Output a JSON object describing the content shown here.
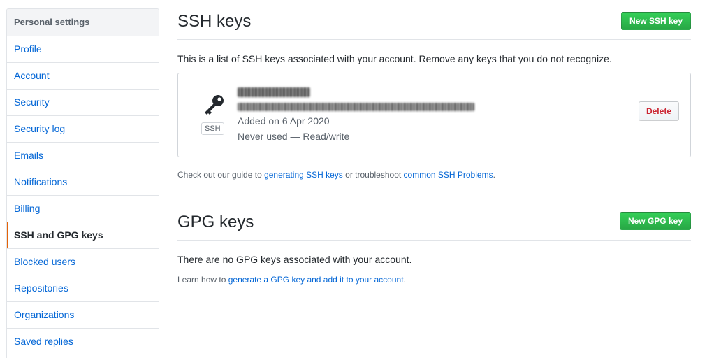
{
  "sidebar": {
    "header": "Personal settings",
    "items": [
      {
        "label": "Profile"
      },
      {
        "label": "Account"
      },
      {
        "label": "Security"
      },
      {
        "label": "Security log"
      },
      {
        "label": "Emails"
      },
      {
        "label": "Notifications"
      },
      {
        "label": "Billing"
      },
      {
        "label": "SSH and GPG keys",
        "selected": true
      },
      {
        "label": "Blocked users"
      },
      {
        "label": "Repositories"
      },
      {
        "label": "Organizations"
      },
      {
        "label": "Saved replies"
      }
    ]
  },
  "ssh": {
    "title": "SSH keys",
    "new_button": "New SSH key",
    "description": "This is a list of SSH keys associated with your account. Remove any keys that you do not recognize.",
    "key": {
      "type_badge": "SSH",
      "added": "Added on 6 Apr 2020",
      "usage": "Never used — Read/write",
      "delete_button": "Delete",
      "icon": "key-icon"
    },
    "guide": {
      "prefix": "Check out our guide to ",
      "link1": "generating SSH keys",
      "middle": " or troubleshoot ",
      "link2": "common SSH Problems",
      "suffix": "."
    }
  },
  "gpg": {
    "title": "GPG keys",
    "new_button": "New GPG key",
    "empty_text": "There are no GPG keys associated with your account.",
    "learn": {
      "prefix": "Learn how to ",
      "link": "generate a GPG key and add it to your account",
      "suffix": "."
    }
  },
  "colors": {
    "accent": "#0366d6",
    "primary_button": "#28a745",
    "danger": "#cb2431",
    "selected_marker": "#e36209"
  }
}
